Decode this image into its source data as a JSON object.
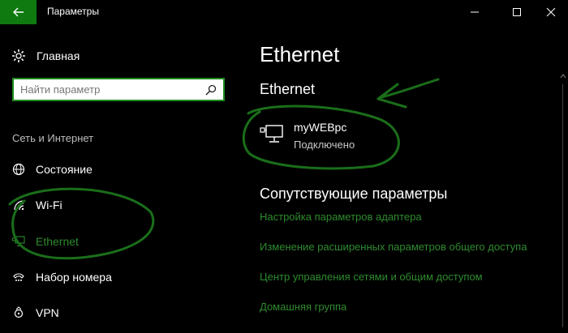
{
  "window": {
    "title": "Параметры"
  },
  "sidebar": {
    "home_label": "Главная",
    "search_placeholder": "Найти параметр",
    "section_title": "Сеть и Интернет",
    "items": [
      {
        "label": "Состояние",
        "icon": "globe-icon",
        "active": false
      },
      {
        "label": "Wi-Fi",
        "icon": "wifi-icon",
        "active": false
      },
      {
        "label": "Ethernet",
        "icon": "ethernet-icon",
        "active": true
      },
      {
        "label": "Набор номера",
        "icon": "dialup-icon",
        "active": false
      },
      {
        "label": "VPN",
        "icon": "vpn-icon",
        "active": false
      }
    ]
  },
  "main": {
    "page_title": "Ethernet",
    "section_title": "Ethernet",
    "network": {
      "name": "myWEBpc",
      "status": "Подключено"
    },
    "related_title": "Сопутствующие параметры",
    "links": [
      "Настройка параметров адаптера",
      "Изменение расширенных параметров общего доступа",
      "Центр управления сетями и общим доступом",
      "Домашняя группа"
    ]
  },
  "colors": {
    "accent": "#0f7a0f",
    "link": "#2e8b2e",
    "background": "#000000",
    "annotation": "#1a6e1a"
  }
}
